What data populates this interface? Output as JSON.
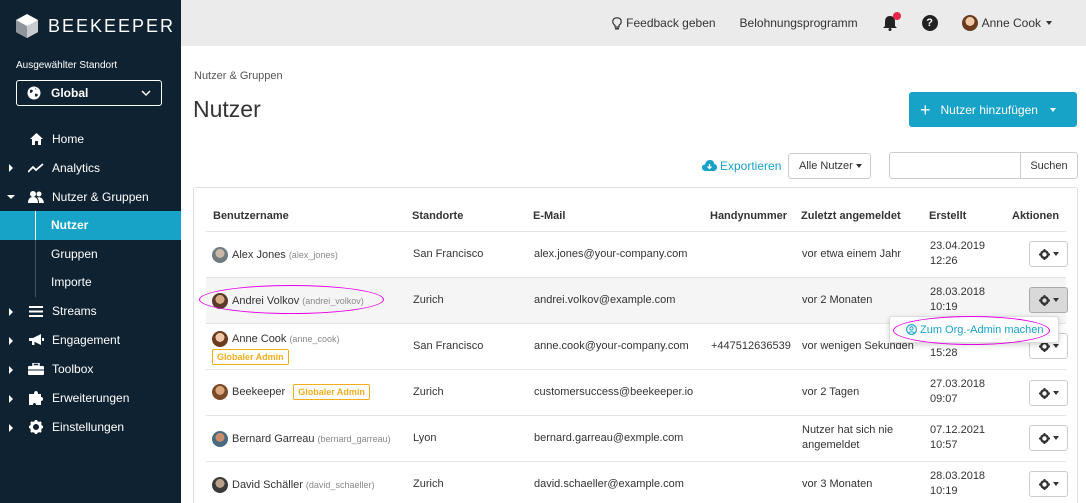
{
  "brand": {
    "name": "BEEKEEPER"
  },
  "location": {
    "label": "Ausgewählter Standort",
    "value": "Global"
  },
  "nav": [
    {
      "label": "Home",
      "icon": "home-icon",
      "expandable": false
    },
    {
      "label": "Analytics",
      "icon": "analytics-icon",
      "expandable": true
    },
    {
      "label": "Nutzer & Gruppen",
      "icon": "users-icon",
      "expandable": true,
      "expanded": true,
      "children": [
        {
          "label": "Nutzer",
          "active": true
        },
        {
          "label": "Gruppen",
          "active": false
        },
        {
          "label": "Importe",
          "active": false
        }
      ]
    },
    {
      "label": "Streams",
      "icon": "streams-icon",
      "expandable": true
    },
    {
      "label": "Engagement",
      "icon": "megaphone-icon",
      "expandable": true
    },
    {
      "label": "Toolbox",
      "icon": "toolbox-icon",
      "expandable": true
    },
    {
      "label": "Erweiterungen",
      "icon": "puzzle-icon",
      "expandable": true
    },
    {
      "label": "Einstellungen",
      "icon": "gear-icon",
      "expandable": true
    }
  ],
  "topbar": {
    "feedback": "Feedback geben",
    "rewards": "Belohnungsprogramm",
    "help": "?",
    "user": "Anne Cook"
  },
  "breadcrumb": "Nutzer & Gruppen",
  "title": "Nutzer",
  "add_button": "Nutzer hinzufügen",
  "toolbar": {
    "export": "Exportieren",
    "filter": "Alle Nutzer",
    "search_placeholder": "",
    "search_button": "Suchen"
  },
  "table": {
    "headers": [
      "Benutzername",
      "Standorte",
      "E-Mail",
      "Handynummer",
      "Zuletzt angemeldet",
      "Erstellt",
      "Aktionen"
    ],
    "rows": [
      {
        "name": "Alex Jones",
        "handle": "(alex_jones)",
        "badge": "",
        "location": "San Francisco",
        "email": "alex.jones@your-company.com",
        "phone": "",
        "last_login": "vor etwa einem Jahr",
        "created_date": "23.04.2019",
        "created_time": "12:26"
      },
      {
        "name": "Andrei Volkov",
        "handle": "(andrei_volkov)",
        "badge": "",
        "location": "Zurich",
        "email": "andrei.volkov@example.com",
        "phone": "",
        "last_login": "vor 2 Monaten",
        "created_date": "28.03.2018",
        "created_time": "10:19"
      },
      {
        "name": "Anne Cook",
        "handle": "(anne_cook)",
        "badge": "Globaler Admin",
        "location": "San Francisco",
        "email": "anne.cook@your-company.com",
        "phone": "+447512636539",
        "last_login": "vor wenigen Sekunden",
        "created_date": "",
        "created_time": "15:28"
      },
      {
        "name": "Beekeeper",
        "handle": "",
        "badge": "Globaler Admin",
        "location": "Zurich",
        "email": "customersuccess@beekeeper.io",
        "phone": "",
        "last_login": "vor 2 Tagen",
        "created_date": "27.03.2018",
        "created_time": "09:07"
      },
      {
        "name": "Bernard Garreau",
        "handle": "(bernard_garreau)",
        "badge": "",
        "location": "Lyon",
        "email": "bernard.garreau@exmple.com",
        "phone": "",
        "last_login": "Nutzer hat sich nie angemeldet",
        "created_date": "07.12.2021",
        "created_time": "10:57"
      },
      {
        "name": "David Schäller",
        "handle": "(david_schaeller)",
        "badge": "",
        "location": "Zurich",
        "email": "david.schaeller@example.com",
        "phone": "",
        "last_login": "vor 3 Monaten",
        "created_date": "28.03.2018",
        "created_time": "10:19"
      }
    ]
  },
  "action_menu": {
    "item": "Zum Org.-Admin machen"
  },
  "colors": {
    "accent": "#17a2c7",
    "sidebar": "#0f2231",
    "badge": "#f0ad1e",
    "highlight": "#e500e5"
  }
}
